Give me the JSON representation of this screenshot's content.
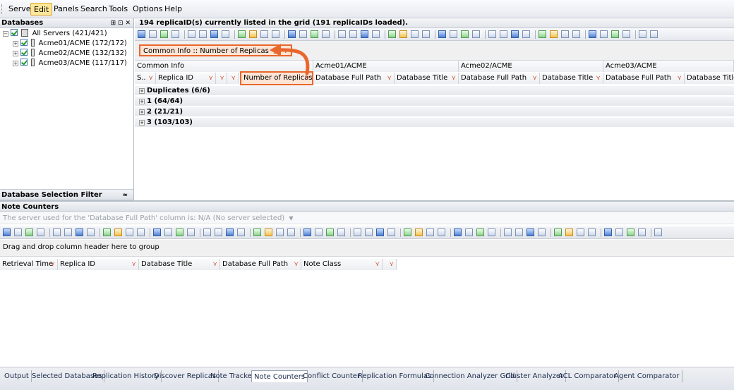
{
  "menu": [
    "Server",
    "Edit",
    "Panels",
    "Search",
    "Tools",
    "Options",
    "Help"
  ],
  "left_panel": {
    "title": "Databases",
    "tree": [
      {
        "label": "All Servers  (421/421)"
      },
      {
        "label": "Acme01/ACME  (172/172)"
      },
      {
        "label": "Acme02/ACME  (132/132)"
      },
      {
        "label": "Acme03/ACME  (117/117)"
      }
    ],
    "filter_label": "Database Selection Filter"
  },
  "main": {
    "status": "194 replicaID(s) currently listed in the grid (191 replicaIDs loaded).",
    "group_chip": "Common Info :: Number of Replicas",
    "band_headers": [
      "Common Info",
      "Acme01/ACME",
      "Acme02/ACME",
      "Acme03/ACME"
    ],
    "columns": [
      "S..",
      "Replica ID",
      "",
      "",
      "Number of Replicas",
      "Database Full Path",
      "Database Title",
      "Database Full Path",
      "Database Title",
      "Database Full Path",
      "Database Title"
    ],
    "groups": [
      "Duplicates (6/6)",
      "1 (64/64)",
      "2 (21/21)",
      "3 (103/103)"
    ]
  },
  "note_counters": {
    "title": "Note Counters",
    "server_info": "The server used for the 'Database Full Path' column is:  N/A (No server selected)",
    "drag_hint": "Drag and drop column header here to group",
    "columns": [
      "Retrieval Time",
      "Replica ID",
      "Database Title",
      "Database Full Path",
      "Note Class",
      ""
    ]
  },
  "tabs": [
    "Output",
    "Selected Databases",
    "Replication History",
    "Discover Replicas",
    "Note Tracker",
    "Note Counters",
    "Conflict Counter",
    "Replication Formulas",
    "Connection Analyzer Grid",
    "Cluster Analyzer",
    "ACL Comparator",
    "Agent Comparator"
  ],
  "active_tab": "Note Counters",
  "accent_color": "#e9672c"
}
